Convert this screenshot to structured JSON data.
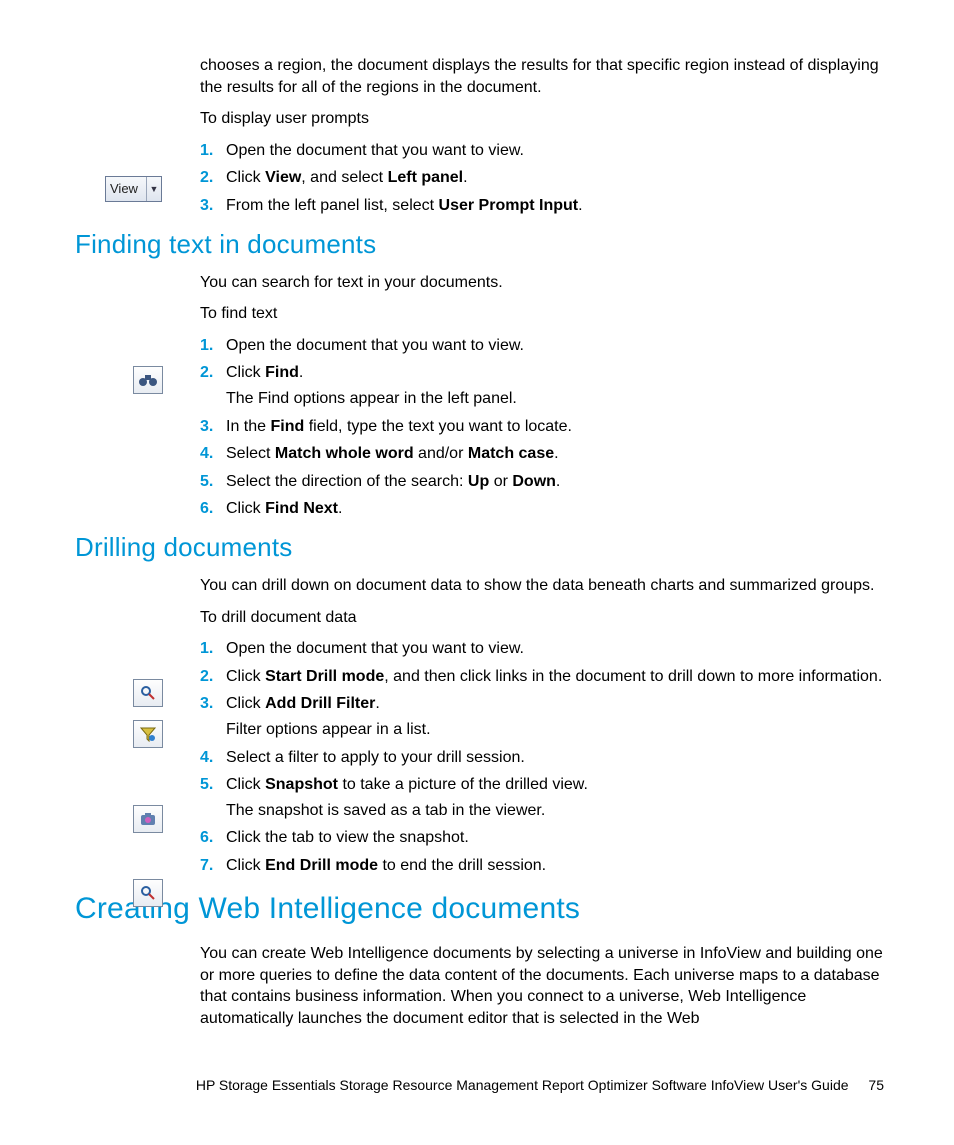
{
  "intro_para": "chooses a region, the document displays the results for that specific region instead of displaying the results for all of the regions in the document.",
  "intro_lead": "To display user prompts",
  "intro_steps": [
    {
      "t": "Open the document that you want to view."
    },
    {
      "pre": "Click ",
      "b1": "View",
      "mid": ", and select ",
      "b2": "Left panel",
      "post": "."
    },
    {
      "pre": "From the left panel list, select ",
      "b1": "User Prompt Input",
      "post": "."
    }
  ],
  "view_label": "View",
  "sec_find": {
    "h": "Finding text in documents",
    "p1": "You can search for text in your documents.",
    "lead": "To find text",
    "s1": "Open the document that you want to view.",
    "s2a": "Click ",
    "s2b": "Find",
    "s2c": ".",
    "s2sub": "The Find options appear in the left panel.",
    "s3a": "In the ",
    "s3b": "Find",
    "s3c": " field, type the text you want to locate.",
    "s4a": "Select ",
    "s4b": "Match whole word",
    "s4c": " and/or ",
    "s4d": "Match case",
    "s4e": ".",
    "s5a": "Select the direction of the search: ",
    "s5b": "Up",
    "s5c": " or ",
    "s5d": "Down",
    "s5e": ".",
    "s6a": "Click ",
    "s6b": "Find Next",
    "s6c": "."
  },
  "sec_drill": {
    "h": "Drilling documents",
    "p1": "You can drill down on document data to show the data beneath charts and summarized groups.",
    "lead": "To drill document data",
    "s1": "Open the document that you want to view.",
    "s2a": "Click ",
    "s2b": "Start Drill mode",
    "s2c": ", and then click links in the document to drill down to more information.",
    "s3a": "Click ",
    "s3b": "Add Drill Filter",
    "s3c": ".",
    "s3sub": "Filter options appear in a list.",
    "s4": "Select a filter to apply to your drill session.",
    "s5a": "Click ",
    "s5b": "Snapshot",
    "s5c": " to take a picture of the drilled view.",
    "s5sub": "The snapshot is saved as a tab in the viewer.",
    "s6": "Click the tab to view the snapshot.",
    "s7a": "Click ",
    "s7b": "End Drill mode",
    "s7c": " to end the drill session."
  },
  "sec_webi": {
    "h": "Creating Web Intelligence documents",
    "p1": "You can create Web Intelligence documents by selecting a universe in InfoView and building one or more queries to define the data content of the documents. Each universe maps to a database that contains business information. When you connect to a universe, Web Intelligence automatically launches the document editor that is selected in the Web"
  },
  "footer": {
    "title": "HP Storage Essentials Storage Resource Management Report Optimizer Software InfoView User's Guide",
    "page": "75"
  }
}
